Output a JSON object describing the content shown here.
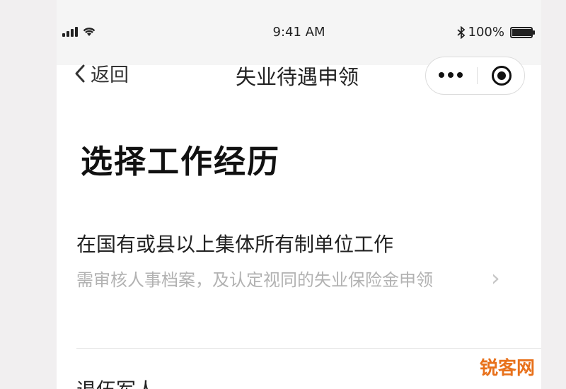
{
  "status_bar": {
    "time": "9:41 AM",
    "battery_text": "100%",
    "battery_level": 1.0,
    "icons": [
      "signal-icon",
      "wifi-icon",
      "bluetooth-icon",
      "battery-icon"
    ]
  },
  "nav": {
    "back_label": "返回",
    "title": "失业待遇申领",
    "icons": [
      "chevron-left-icon",
      "more-icon",
      "target-icon"
    ]
  },
  "page": {
    "heading": "选择工作经历",
    "options": [
      {
        "title": "在国有或县以上集体所有制单位工作",
        "description": "需审核人事档案，及认定视同的失业保险金申领"
      },
      {
        "title": "退伍军人"
      }
    ]
  },
  "watermark": "锐客网",
  "colors": {
    "background": "#f1eff0",
    "text_primary": "#222222",
    "text_secondary": "#b2b2b2",
    "watermark": "#e8711b"
  }
}
